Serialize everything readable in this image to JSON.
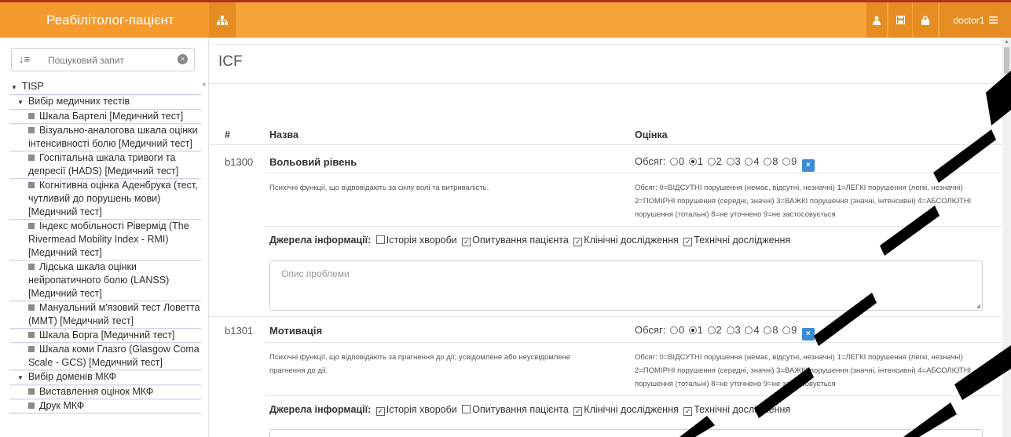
{
  "app": {
    "brand": "Реабілітолог-пацієнт",
    "user": "doctor1",
    "accent": "#f6a33a",
    "icons": [
      "sitemap-icon",
      "person-icon",
      "save-icon",
      "lock-icon",
      "menu-icon"
    ]
  },
  "sidebar": {
    "search_placeholder": "Пошуковий запит",
    "tree": {
      "root": "TISP",
      "group1": "Вибір медичних тестів",
      "tests": [
        "Шкала Бартелі [Медичний тест]",
        "Візуально-аналогова шкала оцінки інтенсивності болю [Медичний тест]",
        "Госпітальна шкала тривоги та депресії (HADS) [Медичний тест]",
        "Когнітивна оцінка Аденбрука (тест, чутливий до порушень мови) [Медичний тест]",
        "Індекс мобільності Рівермід (The Rivermead Mobility Index - RMI) [Медичний тест]",
        "Лідська шкала оцінки нейропатичного болю (LANSS) [Медичний тест]",
        "Мануальний м'язовий тест Ловетта (MMT) [Медичний тест]",
        "Шкала Борга [Медичний тест]",
        "Шкала коми Глазго (Glasgow Coma Scale - GCS) [Медичний тест]"
      ],
      "group2": "Вибір доменів МКФ",
      "domains": [
        "Виставлення оцінок МКФ",
        "Друк МКФ"
      ]
    }
  },
  "main": {
    "title": "ICF",
    "columns": {
      "num": "#",
      "name": "Назва",
      "rating": "Оцінка"
    },
    "scale_label": "Обсяг:",
    "scale_options": [
      "0",
      "1",
      "2",
      "3",
      "4",
      "8",
      "9"
    ],
    "x_label": "×",
    "sources_label": "Джерела інформації:",
    "source_names": [
      "Історія хвороби",
      "Опитування пацієнта",
      "Клінічні дослідження",
      "Технічні дослідження"
    ],
    "textarea_placeholder": "Опис проблеми",
    "legend": "Обсяг: 0=ВІДСУТНІ порушення (немає, відсутні, незначні) 1=ЛЕГКІ порушення (легкі, незначні) 2=ПОМІРНІ порушення (середні, значні) 3=ВАЖКІ порушення (значні, інтенсивні) 4=АБСОЛЮТНІ порушення (тотальні) 8=не уточнено 9=не застосовується",
    "items": [
      {
        "code": "b1300",
        "name": "Вольовий рівень",
        "description": "Психічні функції, що відповідають за силу волі та витривалість.",
        "selected": "1",
        "sources_checked": [
          false,
          true,
          true,
          true
        ]
      },
      {
        "code": "b1301",
        "name": "Мотивація",
        "description": "Психічні функції, що відповідають за прагнення до дії; усвідомлене або неусвідомлене прагнення до дії.",
        "selected": "1",
        "sources_checked": [
          true,
          false,
          true,
          true
        ]
      }
    ]
  }
}
